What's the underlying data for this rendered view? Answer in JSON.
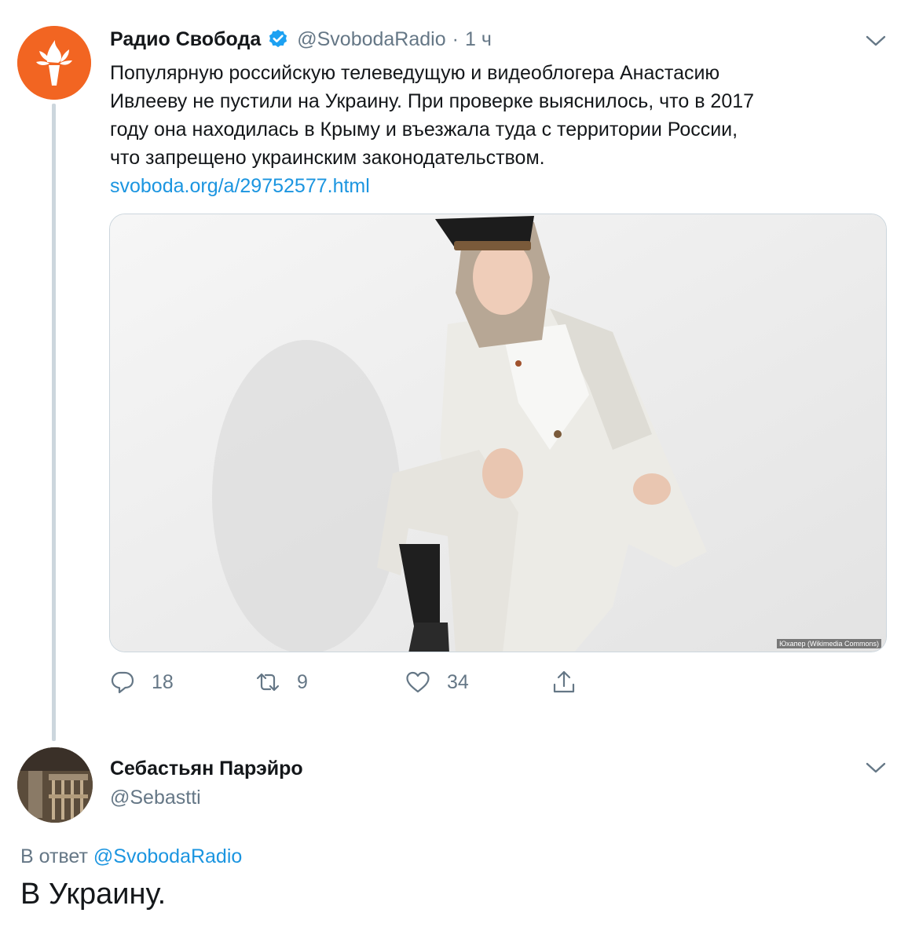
{
  "tweet": {
    "display_name": "Радио Свобода",
    "handle": "@SvobodaRadio",
    "separator": "·",
    "time": "1 ч",
    "text_lines": [
      "Популярную российскую телеведущую и видеоблогера Анастасию",
      "Ивлееву не пустили на Украину. При проверке выяснилось, что в 2017",
      "году она находилась в Крыму и въезжала туда с территории России,",
      "что запрещено украинским законодательством."
    ],
    "link": "svoboda.org/a/29752577.html",
    "media_credit": "Юхапер (Wikimedia Commons)",
    "actions": {
      "replies": "18",
      "retweets": "9",
      "likes": "34"
    }
  },
  "reply": {
    "display_name": "Себастьян Парэйро",
    "handle": "@Sebastti",
    "reply_prefix": "В ответ",
    "reply_mention": "@SvobodaRadio",
    "text": "В Украину."
  },
  "colors": {
    "accent": "#1b95e0",
    "secondary_text": "#657786",
    "brand_orange": "#f26522",
    "thread_line": "#ccd6dd"
  },
  "icons": [
    "verified-badge-icon",
    "chevron-down-icon",
    "reply-icon",
    "retweet-icon",
    "like-icon",
    "share-icon",
    "torch-logo-icon"
  ]
}
